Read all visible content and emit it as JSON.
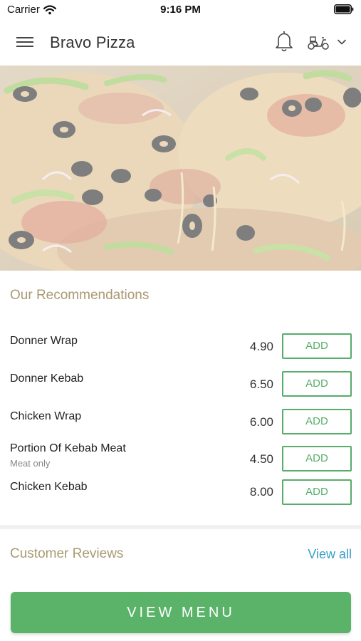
{
  "status_bar": {
    "carrier": "Carrier",
    "time": "9:16 PM"
  },
  "header": {
    "title": "Bravo Pizza"
  },
  "recommendations": {
    "title": "Our Recommendations",
    "items": [
      {
        "name": "Donner Wrap",
        "subtitle": "",
        "price": "4.90",
        "add_label": "ADD"
      },
      {
        "name": "Donner Kebab",
        "subtitle": "",
        "price": "6.50",
        "add_label": "ADD"
      },
      {
        "name": "Chicken Wrap",
        "subtitle": "",
        "price": "6.00",
        "add_label": "ADD"
      },
      {
        "name": "Portion Of Kebab Meat",
        "subtitle": "Meat only",
        "price": "4.50",
        "add_label": "ADD"
      },
      {
        "name": "Chicken Kebab",
        "subtitle": "",
        "price": "8.00",
        "add_label": "ADD"
      }
    ]
  },
  "reviews": {
    "title": "Customer Reviews",
    "view_all": "View all"
  },
  "footer": {
    "view_menu": "VIEW MENU"
  },
  "colors": {
    "accent_green": "#5bb36a",
    "section_title": "#a99a72",
    "link_blue": "#3a9ec9"
  }
}
